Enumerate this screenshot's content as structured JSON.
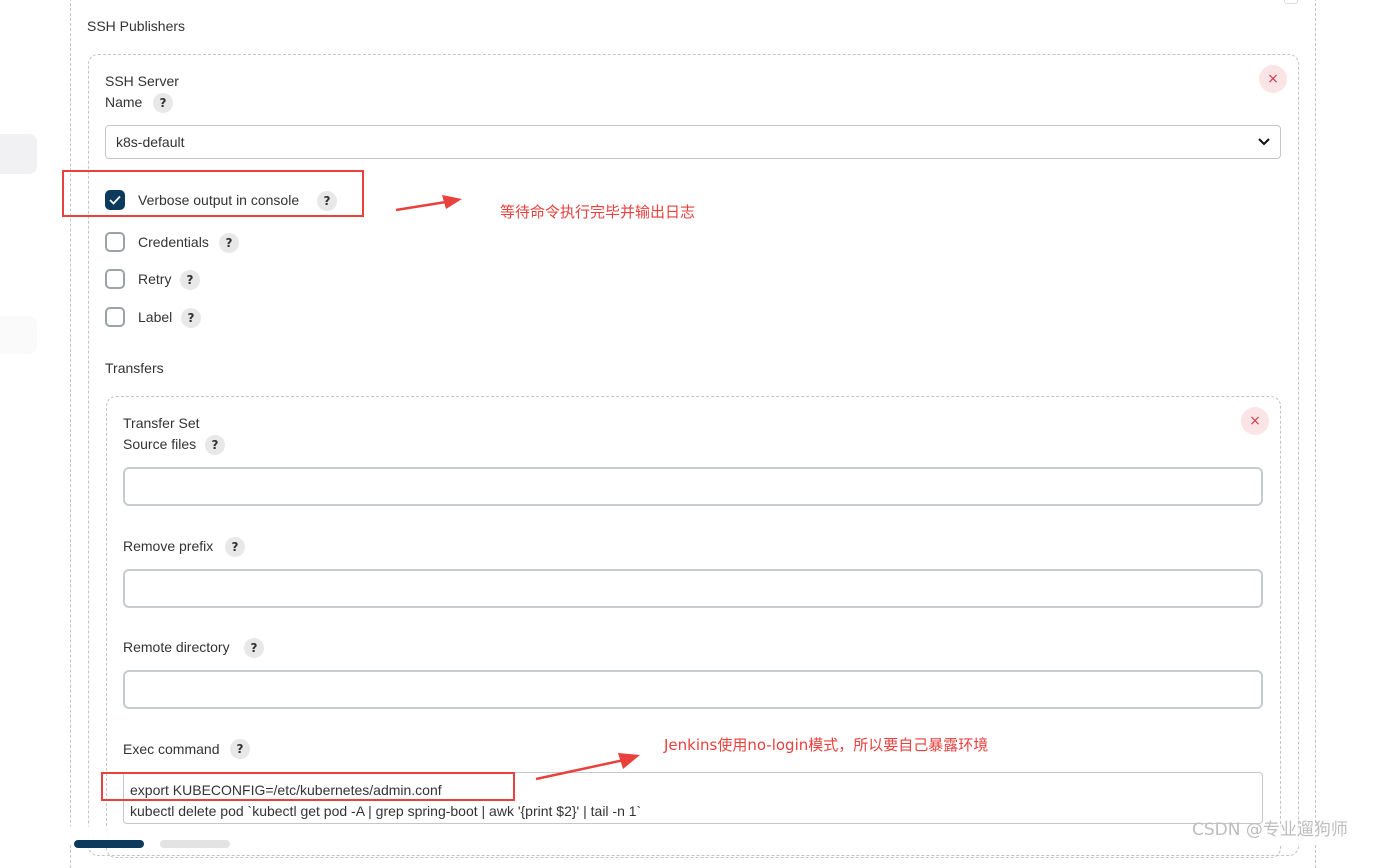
{
  "section_title": "SSH Publishers",
  "ssh_server": {
    "title": "SSH Server",
    "name_label": "Name",
    "name_value": "k8s-default",
    "verbose_label": "Verbose output in console",
    "verbose_checked": true,
    "credentials_label": "Credentials",
    "retry_label": "Retry",
    "label_label": "Label",
    "transfers_label": "Transfers"
  },
  "transfer_set": {
    "title": "Transfer Set",
    "source_files_label": "Source files",
    "source_files_value": "",
    "remove_prefix_label": "Remove prefix",
    "remove_prefix_value": "",
    "remote_directory_label": "Remote directory",
    "remote_directory_value": "",
    "exec_command_label": "Exec command",
    "exec_command_lines": [
      "export KUBECONFIG=/etc/kubernetes/admin.conf",
      "kubectl delete pod `kubectl get pod -A | grep spring-boot | awk '{print $2}' | tail -n 1`"
    ]
  },
  "annotations": {
    "verbose_note": "等待命令执行完毕并输出日志",
    "exec_note": "Jenkins使用no-login模式，所以要自己暴露环境"
  },
  "help_glyph": "?",
  "delete_glyph": "×",
  "watermark": "CSDN @专业遛狗师",
  "colors": {
    "accent": "#0b3a5c",
    "annotation": "#e8413e",
    "danger": "#d23c4b"
  }
}
